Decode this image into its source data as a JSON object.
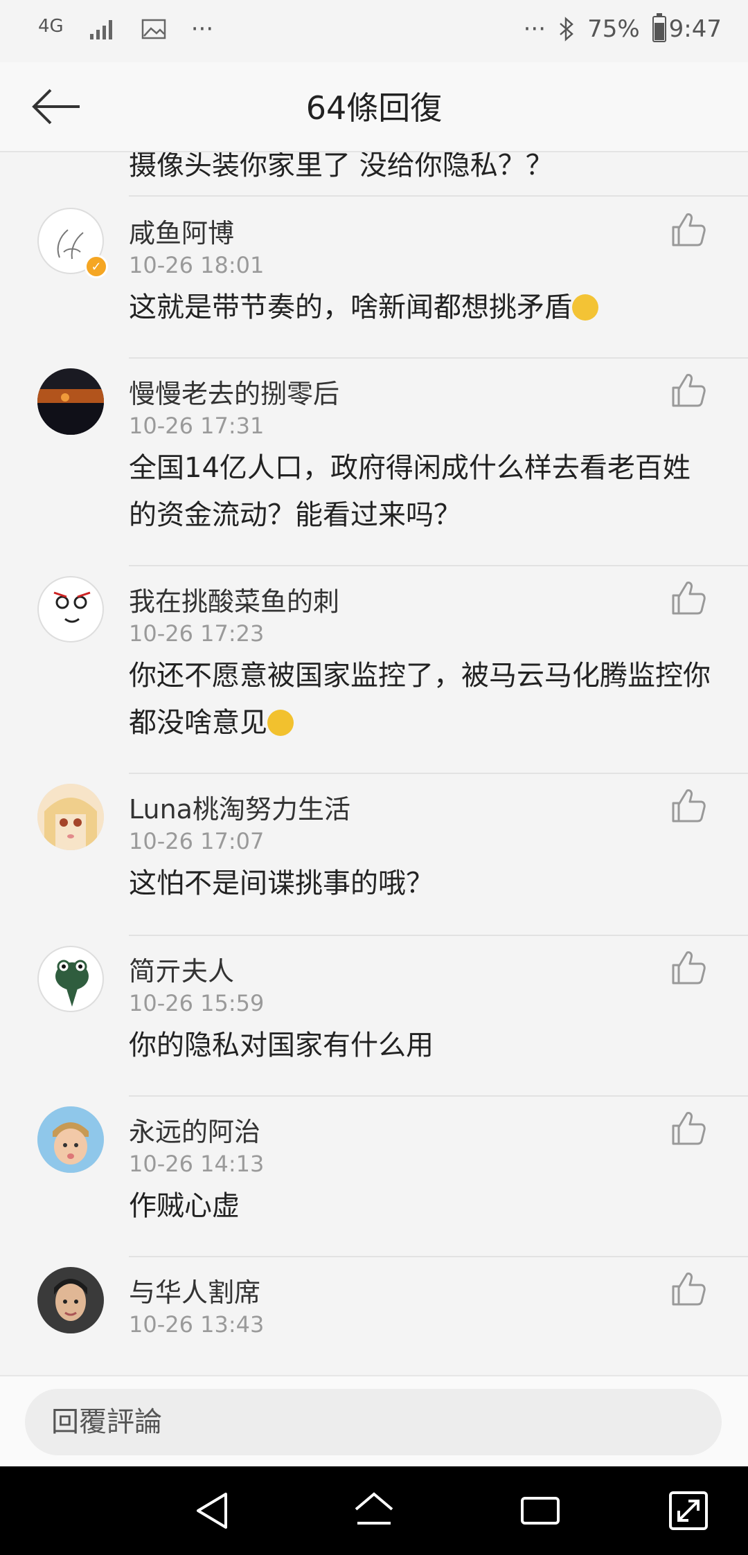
{
  "status": {
    "network": "4G",
    "overflow": "···",
    "overflow_right": "···",
    "battery": "75%",
    "time": "9:47"
  },
  "header": {
    "title": "64條回復"
  },
  "partial_text": "摄像头装你家里了 没给你隐私？？",
  "comments": [
    {
      "name": "咸鱼阿博",
      "time": "10-26 18:01",
      "content": "这就是带节奏的，啥新闻都想挑矛盾",
      "avatar_icon": "hands-avatar-icon",
      "verified": true
    },
    {
      "name": "慢慢老去的捌零后",
      "time": "10-26 17:31",
      "content": "全国14亿人口，政府得闲成什么样去看老百姓的资金流动？能看过来吗？",
      "avatar_icon": "sunset-avatar-icon"
    },
    {
      "name": "我在挑酸菜鱼的刺",
      "time": "10-26 17:23",
      "content": "你还不愿意被国家监控了，被马云马化腾监控你都没啥意见",
      "avatar_icon": "cartoon-face-avatar-icon"
    },
    {
      "name": "Luna桃淘努力生活",
      "time": "10-26 17:07",
      "content": "这怕不是间谍挑事的哦？",
      "avatar_icon": "anime-girl-avatar-icon"
    },
    {
      "name": "简亓夫人",
      "time": "10-26 15:59",
      "content": "你的隐私对国家有什么用",
      "avatar_icon": "frog-avatar-icon"
    },
    {
      "name": "永远的阿治",
      "time": "10-26 14:13",
      "content": "作贼心虚",
      "avatar_icon": "child-avatar-icon"
    },
    {
      "name": "与华人割席",
      "time": "10-26 13:43",
      "content": "",
      "avatar_icon": "woman-avatar-icon"
    }
  ],
  "reply": {
    "placeholder": "回覆評論"
  }
}
